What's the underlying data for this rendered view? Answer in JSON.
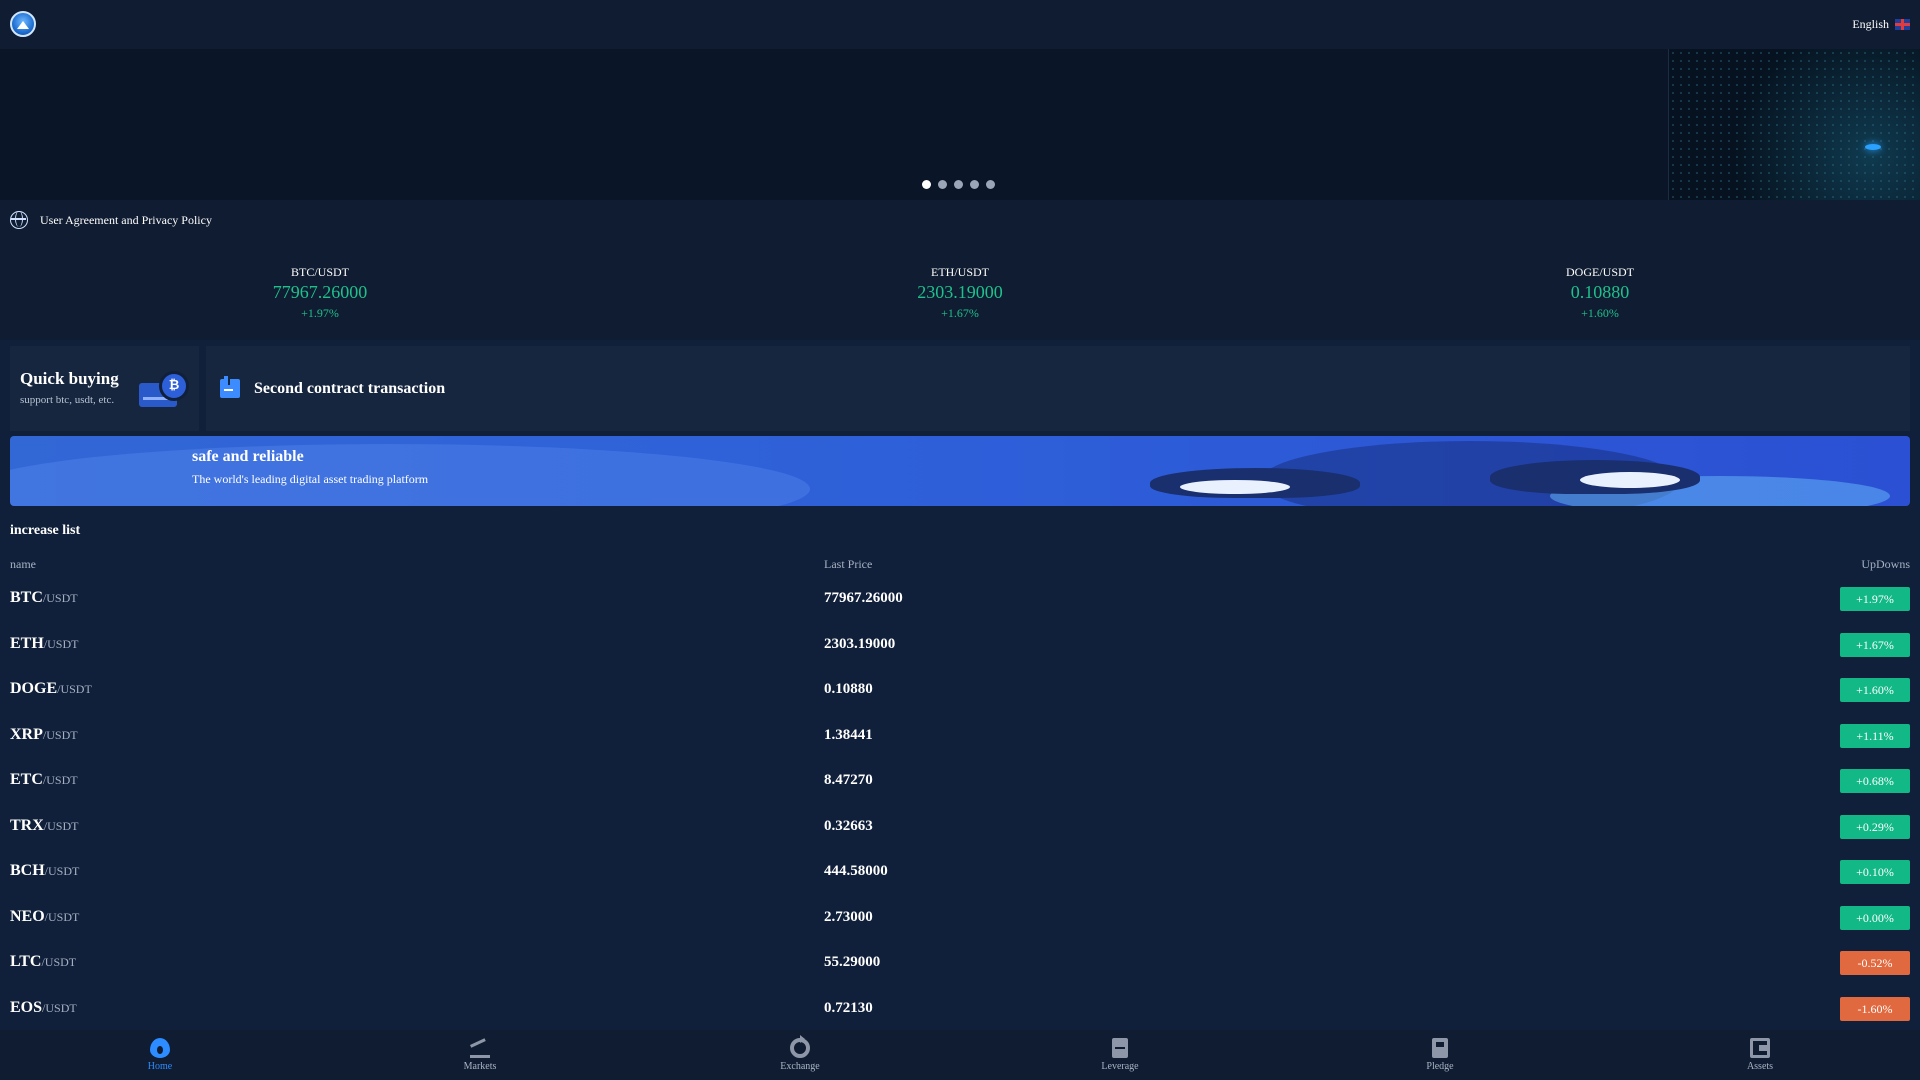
{
  "header": {
    "language_label": "English"
  },
  "banner": {
    "slide_count": 5,
    "active_slide": 1
  },
  "notice": {
    "text": "User Agreement and Privacy Policy"
  },
  "tickers": [
    {
      "pair": "BTC/USDT",
      "price": "77967.26000",
      "change": "+1.97%"
    },
    {
      "pair": "ETH/USDT",
      "price": "2303.19000",
      "change": "+1.67%"
    },
    {
      "pair": "DOGE/USDT",
      "price": "0.10880",
      "change": "+1.60%"
    }
  ],
  "cards": {
    "quick_buying": {
      "title": "Quick buying",
      "subtitle": "support btc, usdt, etc.",
      "icon_glyph": "₿"
    },
    "second_contract": {
      "title": "Second contract transaction"
    }
  },
  "promo": {
    "title": "safe and reliable",
    "subtitle": "The world's leading digital asset trading platform"
  },
  "increase_list": {
    "title": "increase list",
    "headers": {
      "name": "name",
      "price": "Last Price",
      "change": "UpDowns"
    },
    "rows": [
      {
        "base": "BTC",
        "quote": "/USDT",
        "price": "77967.26000",
        "change": "+1.97%",
        "direction": "up"
      },
      {
        "base": "ETH",
        "quote": "/USDT",
        "price": "2303.19000",
        "change": "+1.67%",
        "direction": "up"
      },
      {
        "base": "DOGE",
        "quote": "/USDT",
        "price": "0.10880",
        "change": "+1.60%",
        "direction": "up"
      },
      {
        "base": "XRP",
        "quote": "/USDT",
        "price": "1.38441",
        "change": "+1.11%",
        "direction": "up"
      },
      {
        "base": "ETC",
        "quote": "/USDT",
        "price": "8.47270",
        "change": "+0.68%",
        "direction": "up"
      },
      {
        "base": "TRX",
        "quote": "/USDT",
        "price": "0.32663",
        "change": "+0.29%",
        "direction": "up"
      },
      {
        "base": "BCH",
        "quote": "/USDT",
        "price": "444.58000",
        "change": "+0.10%",
        "direction": "up"
      },
      {
        "base": "NEO",
        "quote": "/USDT",
        "price": "2.73000",
        "change": "+0.00%",
        "direction": "up"
      },
      {
        "base": "LTC",
        "quote": "/USDT",
        "price": "55.29000",
        "change": "-0.52%",
        "direction": "down"
      },
      {
        "base": "EOS",
        "quote": "/USDT",
        "price": "0.72130",
        "change": "-1.60%",
        "direction": "down"
      }
    ]
  },
  "bottom_nav": [
    {
      "label": "Home",
      "icon": "home-flame-icon",
      "active": true
    },
    {
      "label": "Markets",
      "icon": "markets-chart-icon",
      "active": false
    },
    {
      "label": "Exchange",
      "icon": "exchange-refresh-icon",
      "active": false
    },
    {
      "label": "Leverage",
      "icon": "leverage-doc-icon",
      "active": false
    },
    {
      "label": "Pledge",
      "icon": "pledge-doc-icon",
      "active": false
    },
    {
      "label": "Assets",
      "icon": "assets-wallet-icon",
      "active": false
    }
  ],
  "colors": {
    "background": "#11203a",
    "panel": "#0f1c31",
    "up": "#12b886",
    "down": "#e0693f",
    "accent": "#2d8cff",
    "promo_blue": "#2e5fd9"
  }
}
